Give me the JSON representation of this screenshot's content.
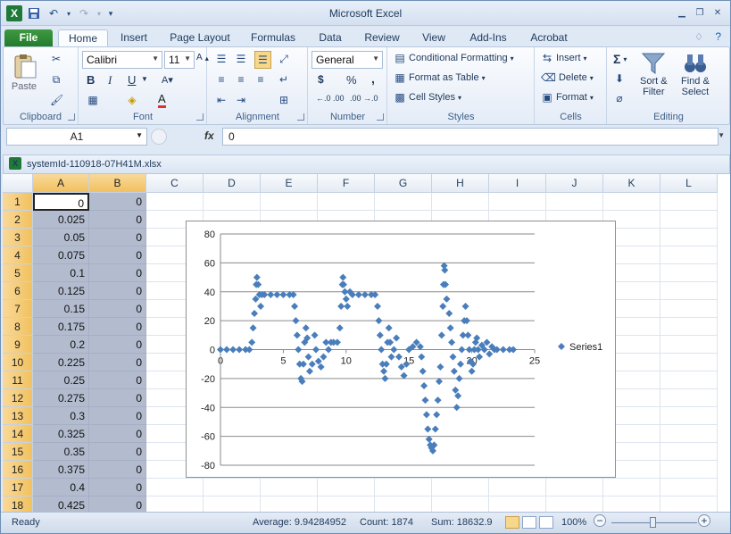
{
  "app": {
    "title": "Microsoft Excel",
    "file_letter": "X"
  },
  "tabs": [
    {
      "label": "File"
    },
    {
      "label": "Home"
    },
    {
      "label": "Insert"
    },
    {
      "label": "Page Layout"
    },
    {
      "label": "Formulas"
    },
    {
      "label": "Data"
    },
    {
      "label": "Review"
    },
    {
      "label": "View"
    },
    {
      "label": "Add-Ins"
    },
    {
      "label": "Acrobat"
    }
  ],
  "ribbon": {
    "clipboard": {
      "label": "Clipboard",
      "paste": "Paste"
    },
    "font": {
      "label": "Font",
      "name": "Calibri",
      "size": "11",
      "bold": "B",
      "italic": "I",
      "underline": "U"
    },
    "alignment": {
      "label": "Alignment"
    },
    "number": {
      "label": "Number",
      "format": "General",
      "currency": "$",
      "percent": "%",
      "comma": ",",
      "inc_decimal": "←.0 .00",
      "dec_decimal": ".00 →.0"
    },
    "styles": {
      "label": "Styles",
      "conditional": "Conditional Formatting",
      "format_table": "Format as Table",
      "cell_styles": "Cell Styles"
    },
    "cells": {
      "label": "Cells",
      "insert": "Insert",
      "delete": "Delete",
      "format": "Format"
    },
    "editing": {
      "label": "Editing",
      "sort_filter_1": "Sort &",
      "sort_filter_2": "Filter",
      "find_select_1": "Find &",
      "find_select_2": "Select"
    }
  },
  "formula_bar": {
    "name_box": "A1",
    "fx": "fx",
    "value": "0"
  },
  "workbook": {
    "title": "systemId-110918-07H41M.xlsx"
  },
  "columns": [
    "A",
    "B",
    "C",
    "D",
    "E",
    "F",
    "G",
    "H",
    "I",
    "J",
    "K",
    "L"
  ],
  "rows": [
    {
      "n": "1",
      "a": "0",
      "b": "0"
    },
    {
      "n": "2",
      "a": "0.025",
      "b": "0"
    },
    {
      "n": "3",
      "a": "0.05",
      "b": "0"
    },
    {
      "n": "4",
      "a": "0.075",
      "b": "0"
    },
    {
      "n": "5",
      "a": "0.1",
      "b": "0"
    },
    {
      "n": "6",
      "a": "0.125",
      "b": "0"
    },
    {
      "n": "7",
      "a": "0.15",
      "b": "0"
    },
    {
      "n": "8",
      "a": "0.175",
      "b": "0"
    },
    {
      "n": "9",
      "a": "0.2",
      "b": "0"
    },
    {
      "n": "10",
      "a": "0.225",
      "b": "0"
    },
    {
      "n": "11",
      "a": "0.25",
      "b": "0"
    },
    {
      "n": "12",
      "a": "0.275",
      "b": "0"
    },
    {
      "n": "13",
      "a": "0.3",
      "b": "0"
    },
    {
      "n": "14",
      "a": "0.325",
      "b": "0"
    },
    {
      "n": "15",
      "a": "0.35",
      "b": "0"
    },
    {
      "n": "16",
      "a": "0.375",
      "b": "0"
    },
    {
      "n": "17",
      "a": "0.4",
      "b": "0"
    },
    {
      "n": "18",
      "a": "0.425",
      "b": "0"
    }
  ],
  "chart_data": {
    "type": "scatter",
    "xlim": [
      0,
      25
    ],
    "ylim": [
      -80,
      80
    ],
    "x_ticks": [
      "0",
      "5",
      "10",
      "15",
      "20",
      "25"
    ],
    "y_ticks": [
      "80",
      "60",
      "40",
      "20",
      "0",
      "-20",
      "-40",
      "-60",
      "-80"
    ],
    "legend_position": "right",
    "gridlines": "horizontal",
    "series": [
      {
        "name": "Series1",
        "color": "#4a7ebb",
        "points": [
          [
            0,
            0
          ],
          [
            0.5,
            0
          ],
          [
            1,
            0
          ],
          [
            1.5,
            0
          ],
          [
            2,
            0
          ],
          [
            2.3,
            0
          ],
          [
            2.5,
            5
          ],
          [
            2.6,
            15
          ],
          [
            2.7,
            25
          ],
          [
            2.8,
            35
          ],
          [
            2.85,
            45
          ],
          [
            2.9,
            50
          ],
          [
            3.0,
            45
          ],
          [
            3.1,
            38
          ],
          [
            3.2,
            30
          ],
          [
            3.3,
            38
          ],
          [
            3.5,
            38
          ],
          [
            4,
            38
          ],
          [
            4.5,
            38
          ],
          [
            5,
            38
          ],
          [
            5.5,
            38
          ],
          [
            5.8,
            38
          ],
          [
            5.9,
            30
          ],
          [
            6.0,
            20
          ],
          [
            6.1,
            10
          ],
          [
            6.2,
            0
          ],
          [
            6.3,
            -10
          ],
          [
            6.4,
            -20
          ],
          [
            6.5,
            -22
          ],
          [
            6.6,
            -10
          ],
          [
            6.7,
            5
          ],
          [
            6.8,
            15
          ],
          [
            6.9,
            8
          ],
          [
            7.0,
            -5
          ],
          [
            7.1,
            -15
          ],
          [
            7.3,
            -10
          ],
          [
            7.5,
            10
          ],
          [
            7.6,
            0
          ],
          [
            7.8,
            -8
          ],
          [
            8.0,
            -12
          ],
          [
            8.2,
            -5
          ],
          [
            8.4,
            5
          ],
          [
            8.6,
            0
          ],
          [
            8.8,
            5
          ],
          [
            9,
            5
          ],
          [
            9.3,
            5
          ],
          [
            9.5,
            15
          ],
          [
            9.6,
            30
          ],
          [
            9.7,
            45
          ],
          [
            9.75,
            50
          ],
          [
            9.8,
            45
          ],
          [
            9.9,
            40
          ],
          [
            10.0,
            35
          ],
          [
            10.1,
            30
          ],
          [
            10.3,
            40
          ],
          [
            10.5,
            38
          ],
          [
            11,
            38
          ],
          [
            11.5,
            38
          ],
          [
            12,
            38
          ],
          [
            12.3,
            38
          ],
          [
            12.5,
            30
          ],
          [
            12.6,
            20
          ],
          [
            12.7,
            10
          ],
          [
            12.8,
            0
          ],
          [
            12.9,
            -10
          ],
          [
            13.0,
            -15
          ],
          [
            13.1,
            -20
          ],
          [
            13.2,
            -10
          ],
          [
            13.3,
            5
          ],
          [
            13.4,
            15
          ],
          [
            13.5,
            5
          ],
          [
            13.6,
            -5
          ],
          [
            13.8,
            0
          ],
          [
            14.0,
            8
          ],
          [
            14.2,
            -5
          ],
          [
            14.4,
            -12
          ],
          [
            14.6,
            -18
          ],
          [
            14.8,
            -10
          ],
          [
            15.0,
            0
          ],
          [
            15.3,
            2
          ],
          [
            15.6,
            5
          ],
          [
            15.9,
            2
          ],
          [
            16.0,
            -5
          ],
          [
            16.1,
            -15
          ],
          [
            16.2,
            -25
          ],
          [
            16.3,
            -35
          ],
          [
            16.4,
            -45
          ],
          [
            16.5,
            -55
          ],
          [
            16.6,
            -62
          ],
          [
            16.7,
            -66
          ],
          [
            16.8,
            -68
          ],
          [
            16.9,
            -70
          ],
          [
            17.0,
            -66
          ],
          [
            17.1,
            -55
          ],
          [
            17.2,
            -45
          ],
          [
            17.3,
            -35
          ],
          [
            17.4,
            -22
          ],
          [
            17.5,
            -12
          ],
          [
            17.6,
            10
          ],
          [
            17.7,
            30
          ],
          [
            17.75,
            45
          ],
          [
            17.8,
            58
          ],
          [
            17.85,
            55
          ],
          [
            17.9,
            45
          ],
          [
            18.0,
            35
          ],
          [
            18.2,
            25
          ],
          [
            18.3,
            15
          ],
          [
            18.4,
            5
          ],
          [
            18.5,
            -5
          ],
          [
            18.6,
            -15
          ],
          [
            18.7,
            -28
          ],
          [
            18.8,
            -40
          ],
          [
            18.9,
            -32
          ],
          [
            19.0,
            -20
          ],
          [
            19.1,
            -10
          ],
          [
            19.2,
            0
          ],
          [
            19.3,
            10
          ],
          [
            19.4,
            20
          ],
          [
            19.5,
            30
          ],
          [
            19.6,
            20
          ],
          [
            19.7,
            10
          ],
          [
            19.8,
            0
          ],
          [
            19.9,
            -8
          ],
          [
            20.0,
            -15
          ],
          [
            20.1,
            -10
          ],
          [
            20.2,
            0
          ],
          [
            20.3,
            5
          ],
          [
            20.4,
            8
          ],
          [
            20.5,
            0
          ],
          [
            20.6,
            -5
          ],
          [
            20.8,
            3
          ],
          [
            21,
            0
          ],
          [
            21.2,
            5
          ],
          [
            21.4,
            -3
          ],
          [
            21.6,
            2
          ],
          [
            21.8,
            0
          ],
          [
            22,
            0
          ],
          [
            22.5,
            0
          ],
          [
            23,
            0
          ],
          [
            23.3,
            0
          ]
        ]
      }
    ]
  },
  "status": {
    "ready": "Ready",
    "average": "Average: 9.94284952",
    "count": "Count: 1874",
    "sum": "Sum: 18632.9",
    "zoom": "100%",
    "zoom_minus": "−",
    "zoom_plus": "+"
  }
}
